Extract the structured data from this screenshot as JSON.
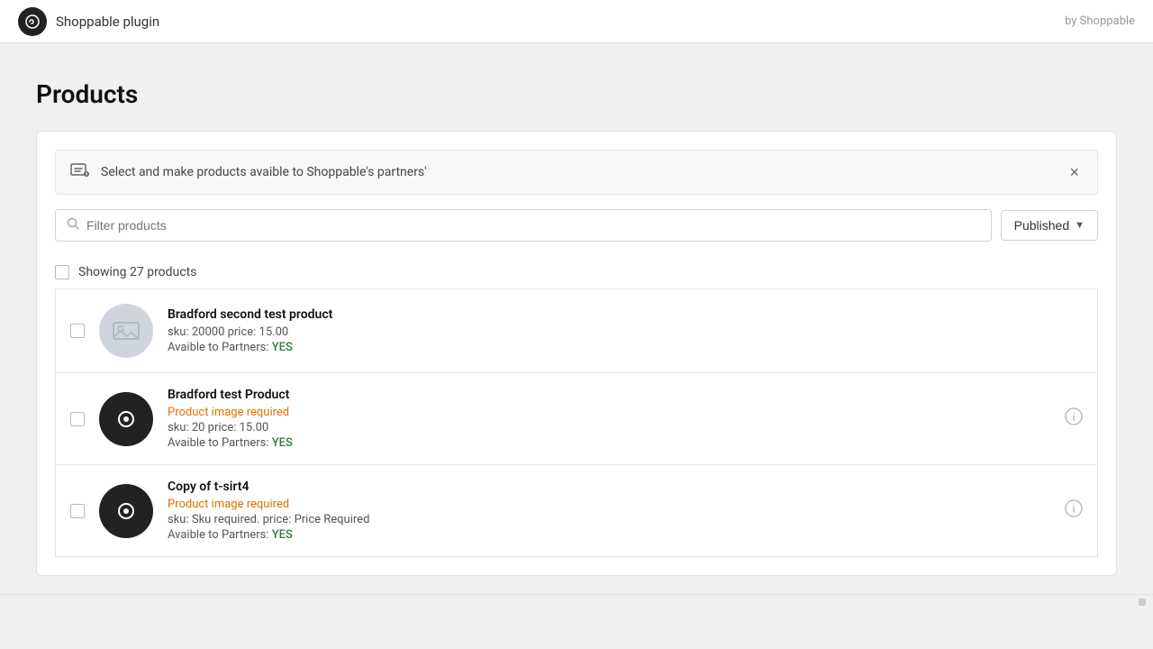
{
  "header": {
    "logo_text": "S",
    "title": "Shoppable plugin",
    "by_label": "by Shoppable"
  },
  "page": {
    "title": "Products"
  },
  "banner": {
    "text": "Select and make products avaible to Shoppable's partners'",
    "close_label": "×"
  },
  "filter": {
    "search_placeholder": "Filter products",
    "published_label": "Published"
  },
  "showing": {
    "text": "Showing 27 products"
  },
  "products": [
    {
      "name": "Bradford second test product",
      "sku_price": "sku: 20000 price: 15.00",
      "available_label": "Avaible to Partners:",
      "available_value": "YES",
      "warning": null,
      "sku_warning": null,
      "price_warning": null,
      "has_info": false,
      "thumbnail_type": "placeholder"
    },
    {
      "name": "Bradford test Product",
      "warning": "Product image required",
      "sku_price": "sku: 20 price: 15.00",
      "available_label": "Avaible to Partners:",
      "available_value": "YES",
      "sku_warning": null,
      "price_warning": null,
      "has_info": true,
      "thumbnail_type": "dark"
    },
    {
      "name": "Copy of t-sirt4",
      "warning": "Product image required",
      "sku_price_label": "sku:",
      "sku_warning": "Sku required.",
      "price_label": "price:",
      "price_warning": "Price Required",
      "available_label": "Avaible to Partners:",
      "available_value": "YES",
      "has_info": true,
      "thumbnail_type": "dark"
    }
  ]
}
